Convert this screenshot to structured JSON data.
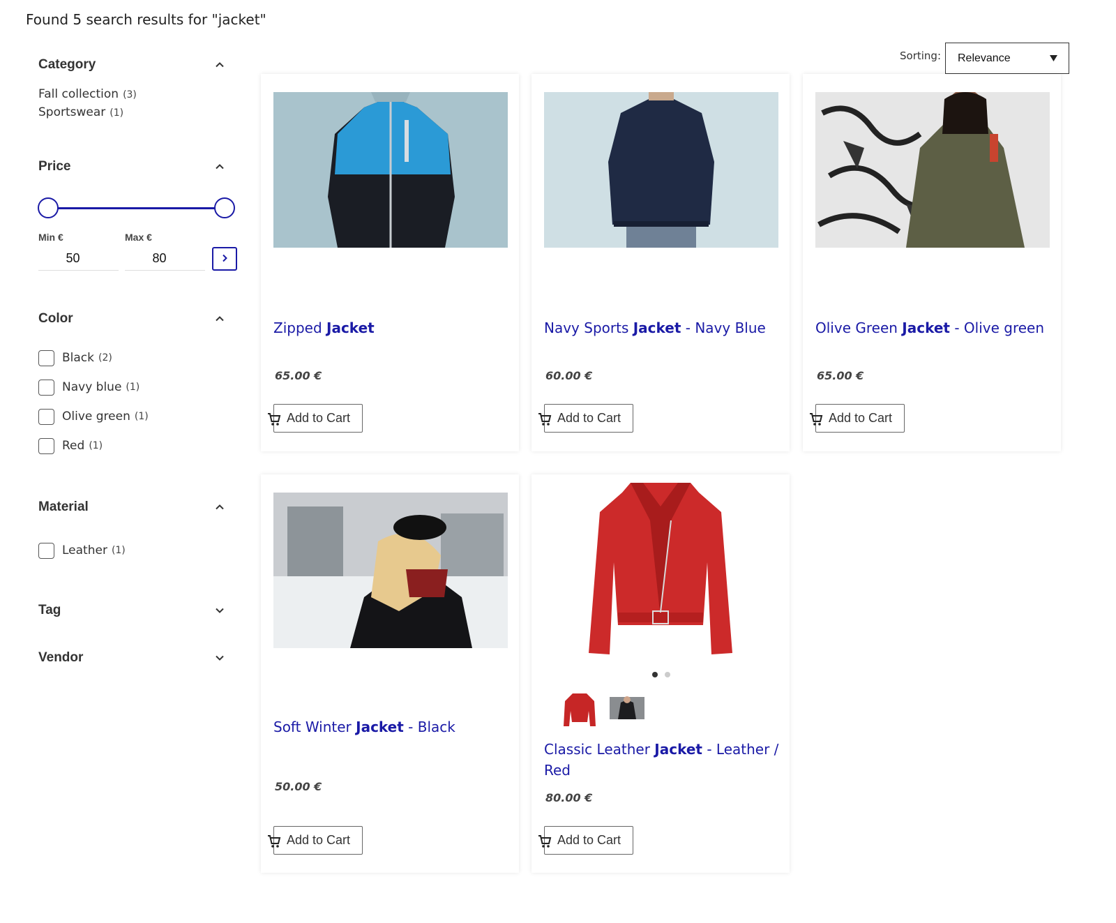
{
  "search": {
    "heading": "Found 5 search results for \"jacket\""
  },
  "filters": {
    "category": {
      "title": "Category",
      "items": [
        {
          "label": "Fall collection",
          "count": "(3)"
        },
        {
          "label": "Sportswear",
          "count": "(1)"
        }
      ]
    },
    "price": {
      "title": "Price",
      "min_label": "Min €",
      "max_label": "Max €",
      "min_value": "50",
      "max_value": "80"
    },
    "color": {
      "title": "Color",
      "items": [
        {
          "label": "Black",
          "count": "(2)"
        },
        {
          "label": "Navy blue",
          "count": "(1)"
        },
        {
          "label": "Olive green",
          "count": "(1)"
        },
        {
          "label": "Red",
          "count": "(1)"
        }
      ]
    },
    "material": {
      "title": "Material",
      "items": [
        {
          "label": "Leather",
          "count": "(1)"
        }
      ]
    },
    "tag": {
      "title": "Tag"
    },
    "vendor": {
      "title": "Vendor"
    }
  },
  "sorting": {
    "label": "Sorting:",
    "selected": "Relevance"
  },
  "products": [
    {
      "title_pre": "Zipped ",
      "title_bold": "Jacket",
      "title_post": "",
      "price": "65.00 €",
      "button": "Add to Cart"
    },
    {
      "title_pre": "Navy Sports ",
      "title_bold": "Jacket",
      "title_post": " - Navy Blue",
      "price": "60.00 €",
      "button": "Add to Cart"
    },
    {
      "title_pre": "Olive Green ",
      "title_bold": "Jacket",
      "title_post": " - Olive green",
      "price": "65.00 €",
      "button": "Add to Cart"
    },
    {
      "title_pre": "Soft Winter ",
      "title_bold": "Jacket",
      "title_post": " - Black",
      "price": "50.00 €",
      "button": "Add to Cart"
    },
    {
      "title_pre": "Classic Leather ",
      "title_bold": "Jacket",
      "title_post": " - Leather / Red",
      "price": "80.00 €",
      "button": "Add to Cart"
    }
  ],
  "colors": {
    "accent": "#1a1aa6",
    "text": "#333333"
  }
}
